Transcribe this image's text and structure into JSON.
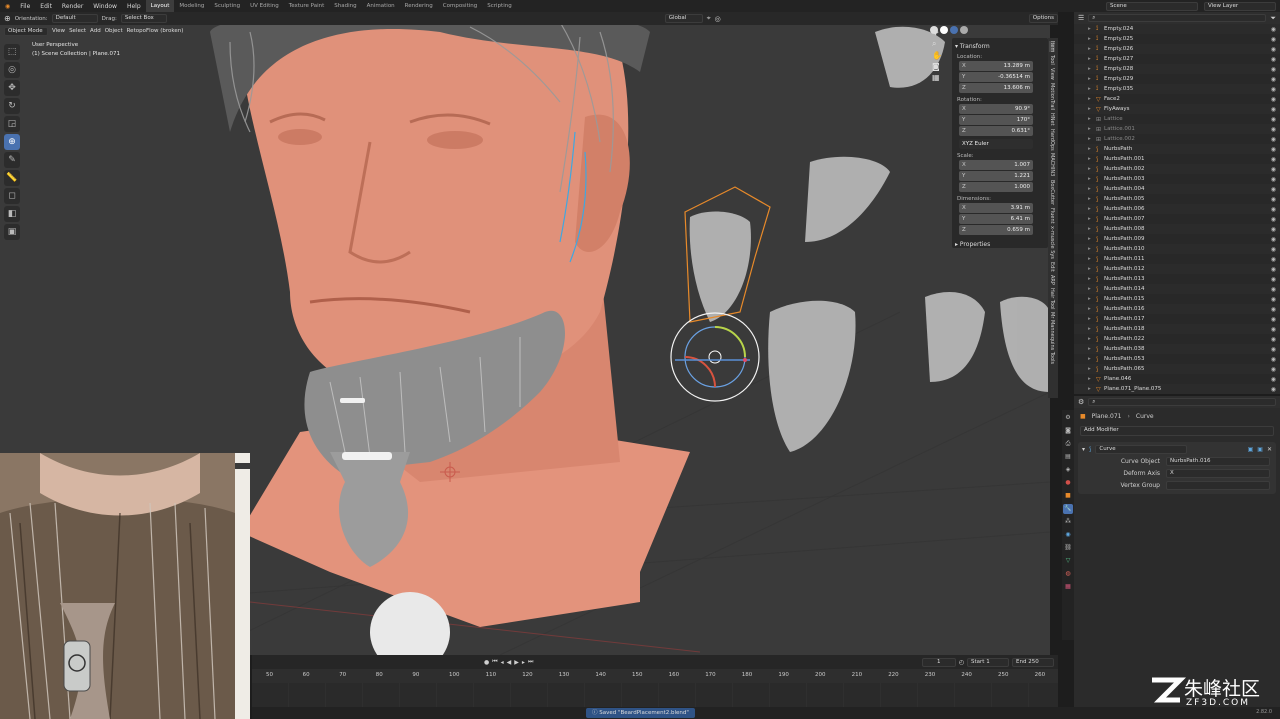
{
  "menu": {
    "items": [
      "File",
      "Edit",
      "Render",
      "Window",
      "Help"
    ],
    "workspaces": [
      "Layout",
      "Modeling",
      "Sculpting",
      "UV Editing",
      "Texture Paint",
      "Shading",
      "Animation",
      "Rendering",
      "Compositing",
      "Scripting"
    ],
    "active_workspace": "Layout",
    "scene_label": "Scene",
    "view_layer_label": "View Layer"
  },
  "header": {
    "orientation_label": "Orientation:",
    "orientation_value": "Default",
    "drag_label": "Drag:",
    "drag_value": "Select Box",
    "transform_space": "Global",
    "options_label": "Options",
    "mode": "Object Mode",
    "menus": [
      "View",
      "Select",
      "Add",
      "Object"
    ],
    "addon_label": "RetopoFlow (broken)"
  },
  "viewport": {
    "perspective_label": "User Perspective",
    "collection_label": "(1) Scene Collection | Plane.071"
  },
  "transform_panel": {
    "title": "Transform",
    "location_label": "Location:",
    "location": [
      {
        "axis": "X",
        "value": "13.289 m"
      },
      {
        "axis": "Y",
        "value": "-0.36514 m"
      },
      {
        "axis": "Z",
        "value": "13.606 m"
      }
    ],
    "rotation_label": "Rotation:",
    "rotation": [
      {
        "axis": "X",
        "value": "90.9°"
      },
      {
        "axis": "Y",
        "value": "170°"
      },
      {
        "axis": "Z",
        "value": "0.631°"
      }
    ],
    "rotation_mode": "XYZ Euler",
    "scale_label": "Scale:",
    "scale": [
      {
        "axis": "X",
        "value": "1.007"
      },
      {
        "axis": "Y",
        "value": "1.221"
      },
      {
        "axis": "Z",
        "value": "1.000"
      }
    ],
    "dimensions_label": "Dimensions:",
    "dimensions": [
      {
        "axis": "X",
        "value": "3.91 m"
      },
      {
        "axis": "Y",
        "value": "6.41 m"
      },
      {
        "axis": "Z",
        "value": "0.659 m"
      }
    ],
    "properties_label": "Properties"
  },
  "sidebar_tabs": [
    "Item",
    "Tool",
    "View",
    "MotionTrail",
    "HNet",
    "HardOps",
    "MACHIN3",
    "BoxCutter",
    "Fluent",
    "x-muscle Sys",
    "Edit",
    "ARP",
    "Hair Tool",
    "Mr Mannequins Tools"
  ],
  "outliner": {
    "search_placeholder": "",
    "items": [
      {
        "name": "Empty.024",
        "icon": "empty"
      },
      {
        "name": "Empty.025",
        "icon": "empty"
      },
      {
        "name": "Empty.026",
        "icon": "empty"
      },
      {
        "name": "Empty.027",
        "icon": "empty"
      },
      {
        "name": "Empty.028",
        "icon": "empty"
      },
      {
        "name": "Empty.029",
        "icon": "empty"
      },
      {
        "name": "Empty.035",
        "icon": "empty"
      },
      {
        "name": "Face2",
        "icon": "mesh"
      },
      {
        "name": "FlyAways",
        "icon": "mesh"
      },
      {
        "name": "Lattice",
        "icon": "lattice"
      },
      {
        "name": "Lattice.001",
        "icon": "lattice"
      },
      {
        "name": "Lattice.002",
        "icon": "lattice"
      },
      {
        "name": "NurbsPath",
        "icon": "curve"
      },
      {
        "name": "NurbsPath.001",
        "icon": "curve"
      },
      {
        "name": "NurbsPath.002",
        "icon": "curve"
      },
      {
        "name": "NurbsPath.003",
        "icon": "curve"
      },
      {
        "name": "NurbsPath.004",
        "icon": "curve"
      },
      {
        "name": "NurbsPath.005",
        "icon": "curve"
      },
      {
        "name": "NurbsPath.006",
        "icon": "curve"
      },
      {
        "name": "NurbsPath.007",
        "icon": "curve"
      },
      {
        "name": "NurbsPath.008",
        "icon": "curve"
      },
      {
        "name": "NurbsPath.009",
        "icon": "curve"
      },
      {
        "name": "NurbsPath.010",
        "icon": "curve"
      },
      {
        "name": "NurbsPath.011",
        "icon": "curve"
      },
      {
        "name": "NurbsPath.012",
        "icon": "curve"
      },
      {
        "name": "NurbsPath.013",
        "icon": "curve"
      },
      {
        "name": "NurbsPath.014",
        "icon": "curve"
      },
      {
        "name": "NurbsPath.015",
        "icon": "curve"
      },
      {
        "name": "NurbsPath.016",
        "icon": "curve"
      },
      {
        "name": "NurbsPath.017",
        "icon": "curve"
      },
      {
        "name": "NurbsPath.018",
        "icon": "curve"
      },
      {
        "name": "NurbsPath.022",
        "icon": "curve"
      },
      {
        "name": "NurbsPath.038",
        "icon": "curve"
      },
      {
        "name": "NurbsPath.053",
        "icon": "curve"
      },
      {
        "name": "NurbsPath.065",
        "icon": "curve"
      },
      {
        "name": "Plane.046",
        "icon": "mesh"
      },
      {
        "name": "Plane.071_Plane.075",
        "icon": "mesh"
      }
    ]
  },
  "properties": {
    "object_name": "Plane.071",
    "modifier_context": "Curve",
    "add_modifier_label": "Add Modifier",
    "modifier_name": "Curve",
    "curve_object_label": "Curve Object",
    "curve_object_value": "NurbsPath.016",
    "deform_axis_label": "Deform Axis",
    "deform_axis_value": "X",
    "vertex_group_label": "Vertex Group",
    "vertex_group_value": ""
  },
  "timeline": {
    "current_frame": "1",
    "start_label": "Start",
    "start_value": "1",
    "end_label": "End",
    "end_value": "250",
    "ticks": [
      "50",
      "60",
      "70",
      "80",
      "90",
      "100",
      "110",
      "120",
      "130",
      "140",
      "150",
      "160",
      "170",
      "180",
      "190",
      "200",
      "210",
      "220",
      "230",
      "240",
      "250",
      "260"
    ]
  },
  "status": {
    "message": "Saved \"BeardPlacement2.blend\"",
    "version": "2.82.0"
  },
  "watermark": {
    "text": "朱峰社区",
    "sub": "ZF3D.COM"
  },
  "colors": {
    "accent": "#4a72b0",
    "skin": "#e3937c",
    "hair": "#a9a9a9",
    "select_orange": "#e88a2a"
  }
}
